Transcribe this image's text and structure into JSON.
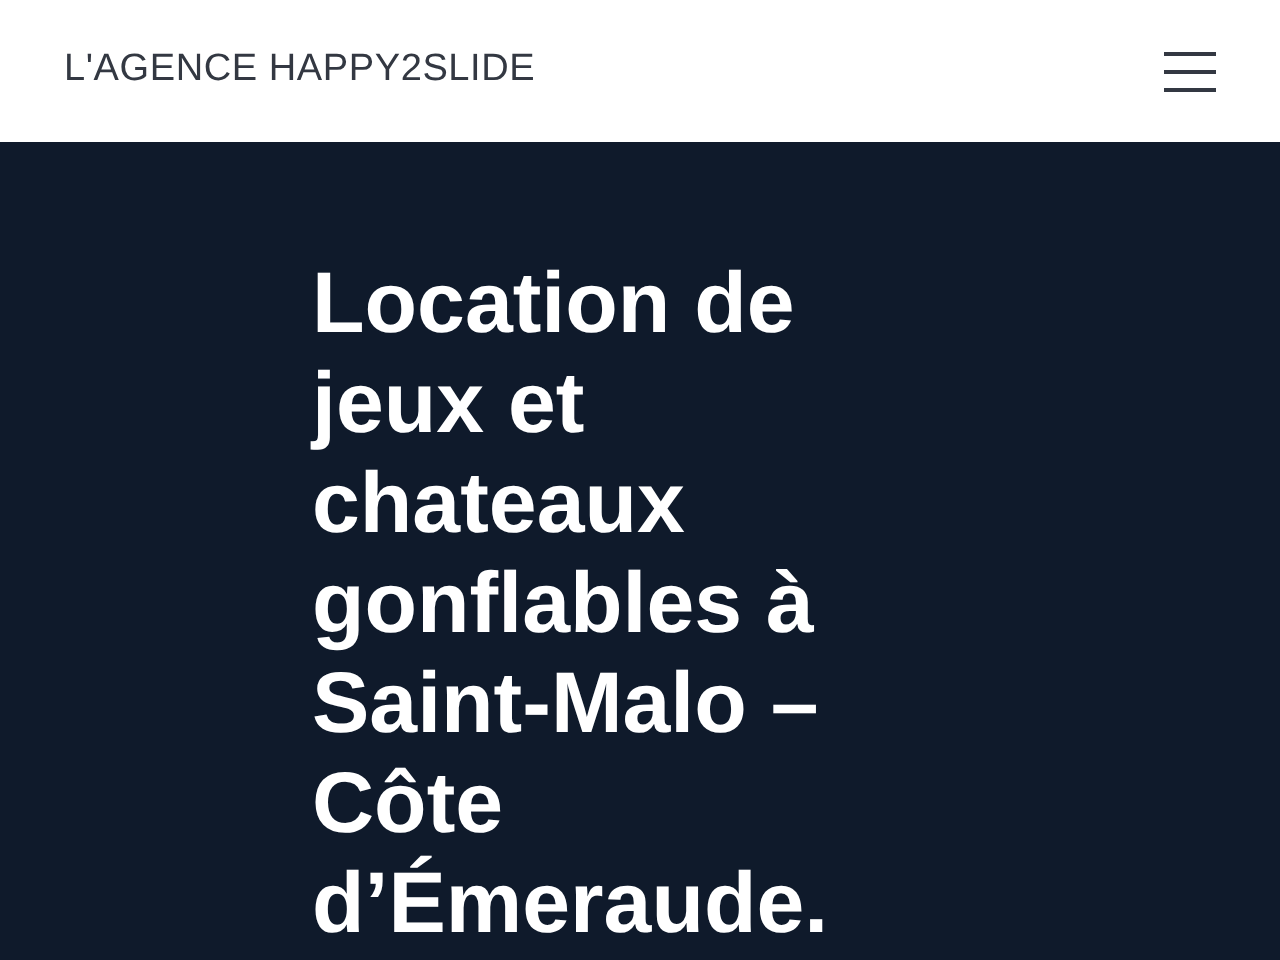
{
  "header": {
    "logo": "L'AGENCE HAPPY2SLIDE"
  },
  "hero": {
    "title": "Location de jeux et chateaux gonflables à Saint-Malo – Côte d’Émeraude."
  }
}
